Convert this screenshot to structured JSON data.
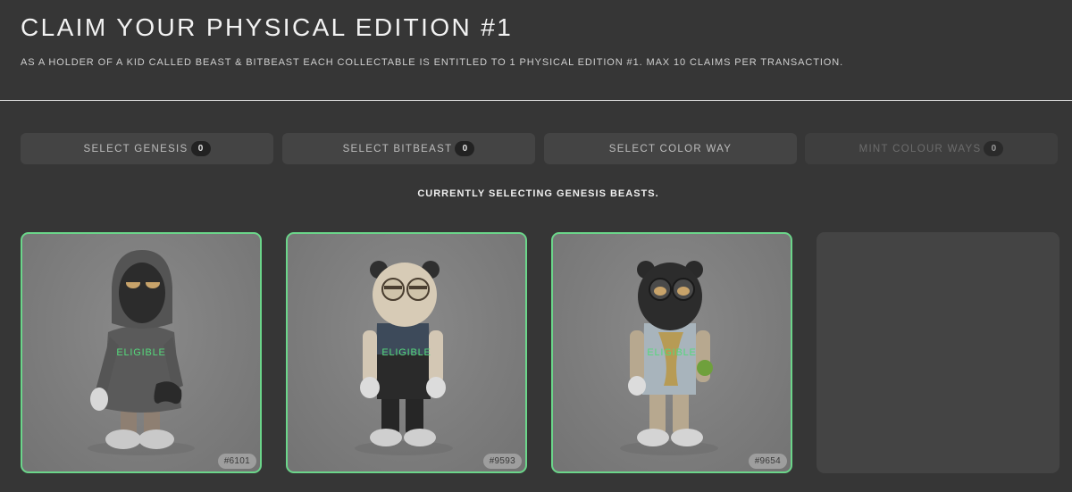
{
  "header": {
    "title": "CLAIM YOUR PHYSICAL EDITION #1",
    "subtitle": "AS A HOLDER OF A KID CALLED BEAST & BITBEAST EACH COLLECTABLE IS ENTITLED TO 1 PHYSICAL EDITION #1. MAX 10 CLAIMS PER TRANSACTION."
  },
  "tabs": [
    {
      "label": "SELECT GENESIS",
      "count": "0"
    },
    {
      "label": "SELECT BITBEAST",
      "count": "0"
    },
    {
      "label": "SELECT COLOR WAY"
    },
    {
      "label": "MINT COLOUR WAYS",
      "count": "0"
    }
  ],
  "status_text": "CURRENTLY SELECTING GENESIS BEASTS.",
  "cards": [
    {
      "status": "ELIGIBLE",
      "id": "#6101"
    },
    {
      "status": "ELIGIBLE",
      "id": "#9593"
    },
    {
      "status": "ELIGIBLE",
      "id": "#9654"
    }
  ],
  "colors": {
    "background": "#363636",
    "tab_background": "#444444",
    "eligible_green": "#55d97b",
    "card_border": "#6bd58a"
  }
}
